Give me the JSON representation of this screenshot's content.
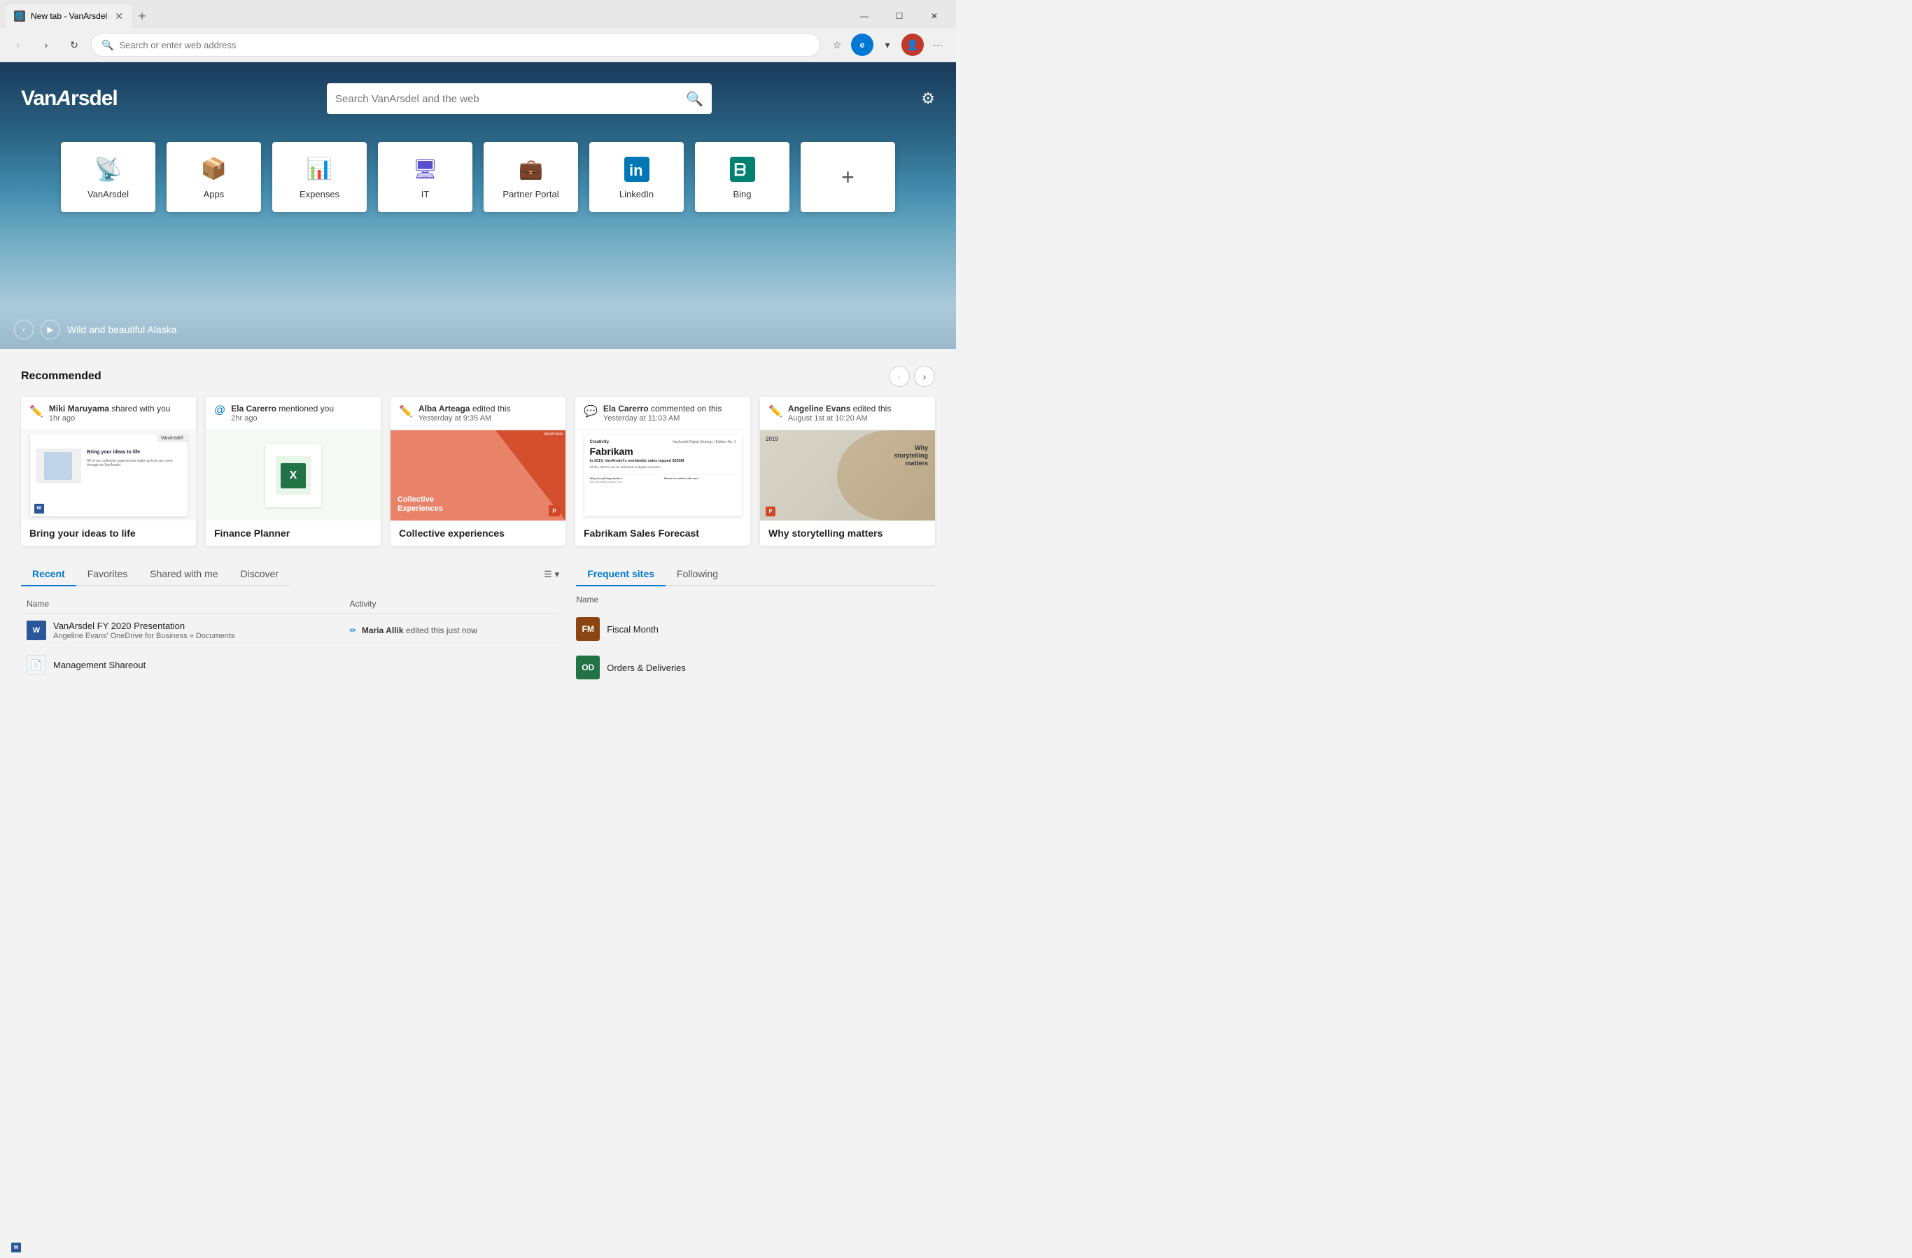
{
  "browser": {
    "tab_label": "New tab - VanArsdel",
    "tab_icon": "🌐",
    "address": "Search or enter web address",
    "window_controls": {
      "minimize": "—",
      "maximize": "☐",
      "close": "✕"
    }
  },
  "hero": {
    "brand": "VanArsdel",
    "search_placeholder": "Search VanArsdel and the web",
    "caption": "Wild and beautiful Alaska",
    "quick_links": [
      {
        "id": "vanarsdel",
        "label": "VanArsdel",
        "icon": "🌐",
        "color": "#0078d4"
      },
      {
        "id": "apps",
        "label": "Apps",
        "icon": "📦",
        "color": "#e8770a"
      },
      {
        "id": "expenses",
        "label": "Expenses",
        "icon": "📊",
        "color": "#217346"
      },
      {
        "id": "it",
        "label": "IT",
        "icon": "🖥",
        "color": "#5a4fcf"
      },
      {
        "id": "partner-portal",
        "label": "Partner Portal",
        "icon": "💼",
        "color": "#8b6914"
      },
      {
        "id": "linkedin",
        "label": "LinkedIn",
        "icon": "in",
        "color": "#0077b5"
      },
      {
        "id": "bing",
        "label": "Bing",
        "icon": "ⓑ",
        "color": "#008272"
      },
      {
        "id": "add",
        "label": "",
        "icon": "+",
        "color": "#555"
      }
    ]
  },
  "recommended": {
    "title": "Recommended",
    "cards": [
      {
        "id": "bring-your-ideas",
        "author": "Miki Maruyama",
        "action": "shared with you",
        "time": "1hr ago",
        "title": "Bring your ideas to life",
        "type": "word"
      },
      {
        "id": "finance-planner",
        "author": "Ela Carerro",
        "action": "mentioned you",
        "time": "2hr ago",
        "title": "Finance Planner",
        "type": "excel"
      },
      {
        "id": "collective-experiences",
        "author": "Alba Arteaga",
        "action": "edited this",
        "time": "Yesterday at 9:35 AM",
        "title": "Collective experiences",
        "type": "ppt-coral"
      },
      {
        "id": "fabrikam-sales",
        "author": "Ela Carerro",
        "action": "commented on this",
        "time": "Yesterday at 11:03 AM",
        "title": "Fabrikam Sales Forecast",
        "type": "word-doc"
      },
      {
        "id": "storytelling",
        "author": "Angeline Evans",
        "action": "edited this",
        "time": "August 1st at 10:20 AM",
        "title": "Why storytelling matters",
        "type": "ppt-neutral"
      }
    ]
  },
  "files": {
    "tabs": [
      {
        "id": "recent",
        "label": "Recent",
        "active": true
      },
      {
        "id": "favorites",
        "label": "Favorites",
        "active": false
      },
      {
        "id": "shared",
        "label": "Shared with me",
        "active": false
      },
      {
        "id": "discover",
        "label": "Discover",
        "active": false
      }
    ],
    "columns": {
      "name": "Name",
      "activity": "Activity"
    },
    "items": [
      {
        "id": "vanarsdel-fy2020",
        "icon": "word",
        "name": "VanArsdel FY 2020 Presentation",
        "sub": "Angeline Evans' OneDrive for Business » Documents",
        "activity_author": "Maria Allik",
        "activity_text": "edited this just now",
        "activity_icon": "pencil"
      },
      {
        "id": "management-shareout",
        "icon": "ppt",
        "name": "Management Shareout",
        "sub": "",
        "activity_author": "",
        "activity_text": "",
        "activity_icon": ""
      }
    ]
  },
  "sites": {
    "tabs": [
      {
        "id": "frequent",
        "label": "Frequent sites",
        "active": true
      },
      {
        "id": "following",
        "label": "Following",
        "active": false
      }
    ],
    "column": "Name",
    "items": [
      {
        "id": "fiscal-month",
        "initials": "FM",
        "name": "Fiscal Month",
        "color": "#8b4513"
      },
      {
        "id": "orders-deliveries",
        "initials": "OD",
        "name": "Orders & Deliveries",
        "color": "#217346"
      }
    ]
  }
}
